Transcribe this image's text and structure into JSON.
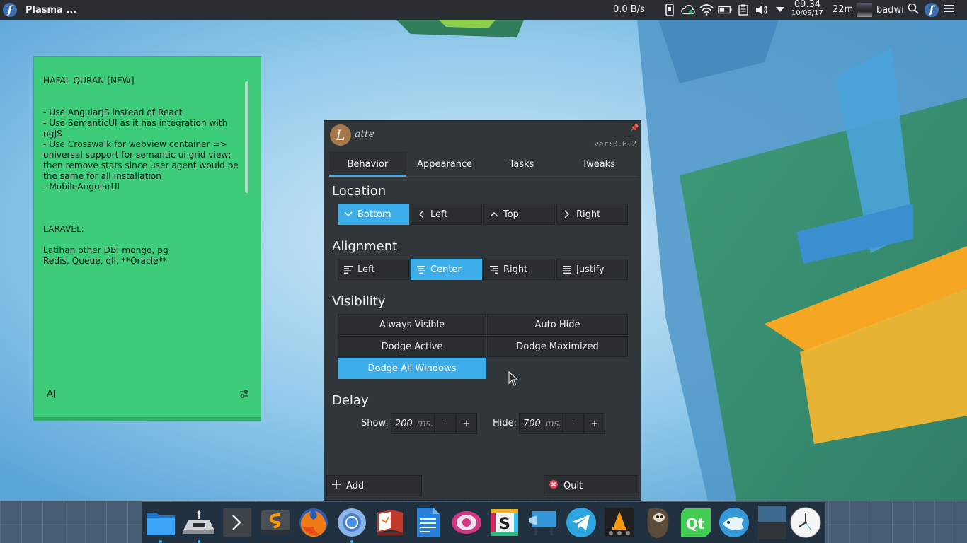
{
  "top_panel": {
    "launcher_icon": "fedora-icon",
    "active_window_title": "Plasma ...",
    "net_speed": "0.0 B/s",
    "tray_icons": [
      "phone-icon",
      "cloud-sync-icon",
      "wifi-icon",
      "battery-icon",
      "clipboard-icon",
      "volume-icon",
      "expand-arrow-icon"
    ],
    "clock_time": "09.34",
    "clock_date": "10/09/17",
    "timer": "22m",
    "user_name": "badwi",
    "right_icons": [
      "search-icon",
      "fedora-icon",
      "hamburger-menu-icon"
    ]
  },
  "note": {
    "text": "HAFAL QURAN [NEW]\n\n\n- Use AngularJS instead of React\n- Use SemanticUI as it has integration with ngJS\n- Use Crosswalk for webview container => universal support for semantic ui grid view; then remove stats since user agent would be the same for all installation\n- MobileAngularUI\n\n\n\nLARAVEL:\n\nLatihan other DB: mongo, pg\nRedis, Queue, dll, **Oracle**",
    "font_button": "A",
    "bg_color": "#3ccc7a"
  },
  "latte": {
    "logo_letter": "L",
    "app_name": "atte",
    "version": "ver:0.6.2",
    "tabs": [
      {
        "label": "Behavior",
        "active": true
      },
      {
        "label": "Appearance",
        "active": false
      },
      {
        "label": "Tasks",
        "active": false
      },
      {
        "label": "Tweaks",
        "active": false
      }
    ],
    "location": {
      "title": "Location",
      "options": [
        {
          "label": "Bottom",
          "icon": "chevron-down-icon",
          "selected": true
        },
        {
          "label": "Left",
          "icon": "chevron-left-icon",
          "selected": false
        },
        {
          "label": "Top",
          "icon": "chevron-up-icon",
          "selected": false
        },
        {
          "label": "Right",
          "icon": "chevron-right-icon",
          "selected": false
        }
      ]
    },
    "alignment": {
      "title": "Alignment",
      "options": [
        {
          "label": "Left",
          "icon": "align-left-icon",
          "selected": false
        },
        {
          "label": "Center",
          "icon": "align-center-icon",
          "selected": true
        },
        {
          "label": "Right",
          "icon": "align-right-icon",
          "selected": false
        },
        {
          "label": "Justify",
          "icon": "align-justify-icon",
          "selected": false
        }
      ]
    },
    "visibility": {
      "title": "Visibility",
      "options": [
        {
          "label": "Always Visible",
          "selected": false
        },
        {
          "label": "Auto Hide",
          "selected": false
        },
        {
          "label": "Dodge Active",
          "selected": false
        },
        {
          "label": "Dodge Maximized",
          "selected": false
        },
        {
          "label": "Dodge All Windows",
          "selected": true
        }
      ]
    },
    "delay": {
      "title": "Delay",
      "show_label": "Show:",
      "show_value": "200",
      "hide_label": "Hide:",
      "hide_value": "700",
      "unit": "ms.",
      "minus": "-",
      "plus": "+"
    },
    "footer": {
      "add_label": "Add",
      "quit_label": "Quit"
    },
    "accent_color": "#3daee9"
  },
  "dock": {
    "apps": [
      {
        "name": "file-manager-icon",
        "running": true
      },
      {
        "name": "usb-drive-icon",
        "running": true
      },
      {
        "name": "terminal-icon",
        "running": false
      },
      {
        "name": "sublime-text-icon",
        "running": false
      },
      {
        "name": "firefox-icon",
        "running": false
      },
      {
        "name": "chromium-icon",
        "running": true
      },
      {
        "name": "book-reader-icon",
        "running": false
      },
      {
        "name": "document-editor-icon",
        "running": false
      },
      {
        "name": "image-viewer-icon",
        "running": false
      },
      {
        "name": "slack-icon",
        "running": false
      },
      {
        "name": "presentation-icon",
        "running": false
      },
      {
        "name": "telegram-icon",
        "running": false
      },
      {
        "name": "vlc-icon",
        "running": false
      },
      {
        "name": "gimp-icon",
        "running": false
      },
      {
        "name": "qt-creator-icon",
        "running": false
      },
      {
        "name": "bluefish-icon",
        "running": false
      },
      {
        "name": "virtual-desktop-pager-icon",
        "running": false
      },
      {
        "name": "analog-clock-icon",
        "running": false
      }
    ]
  }
}
